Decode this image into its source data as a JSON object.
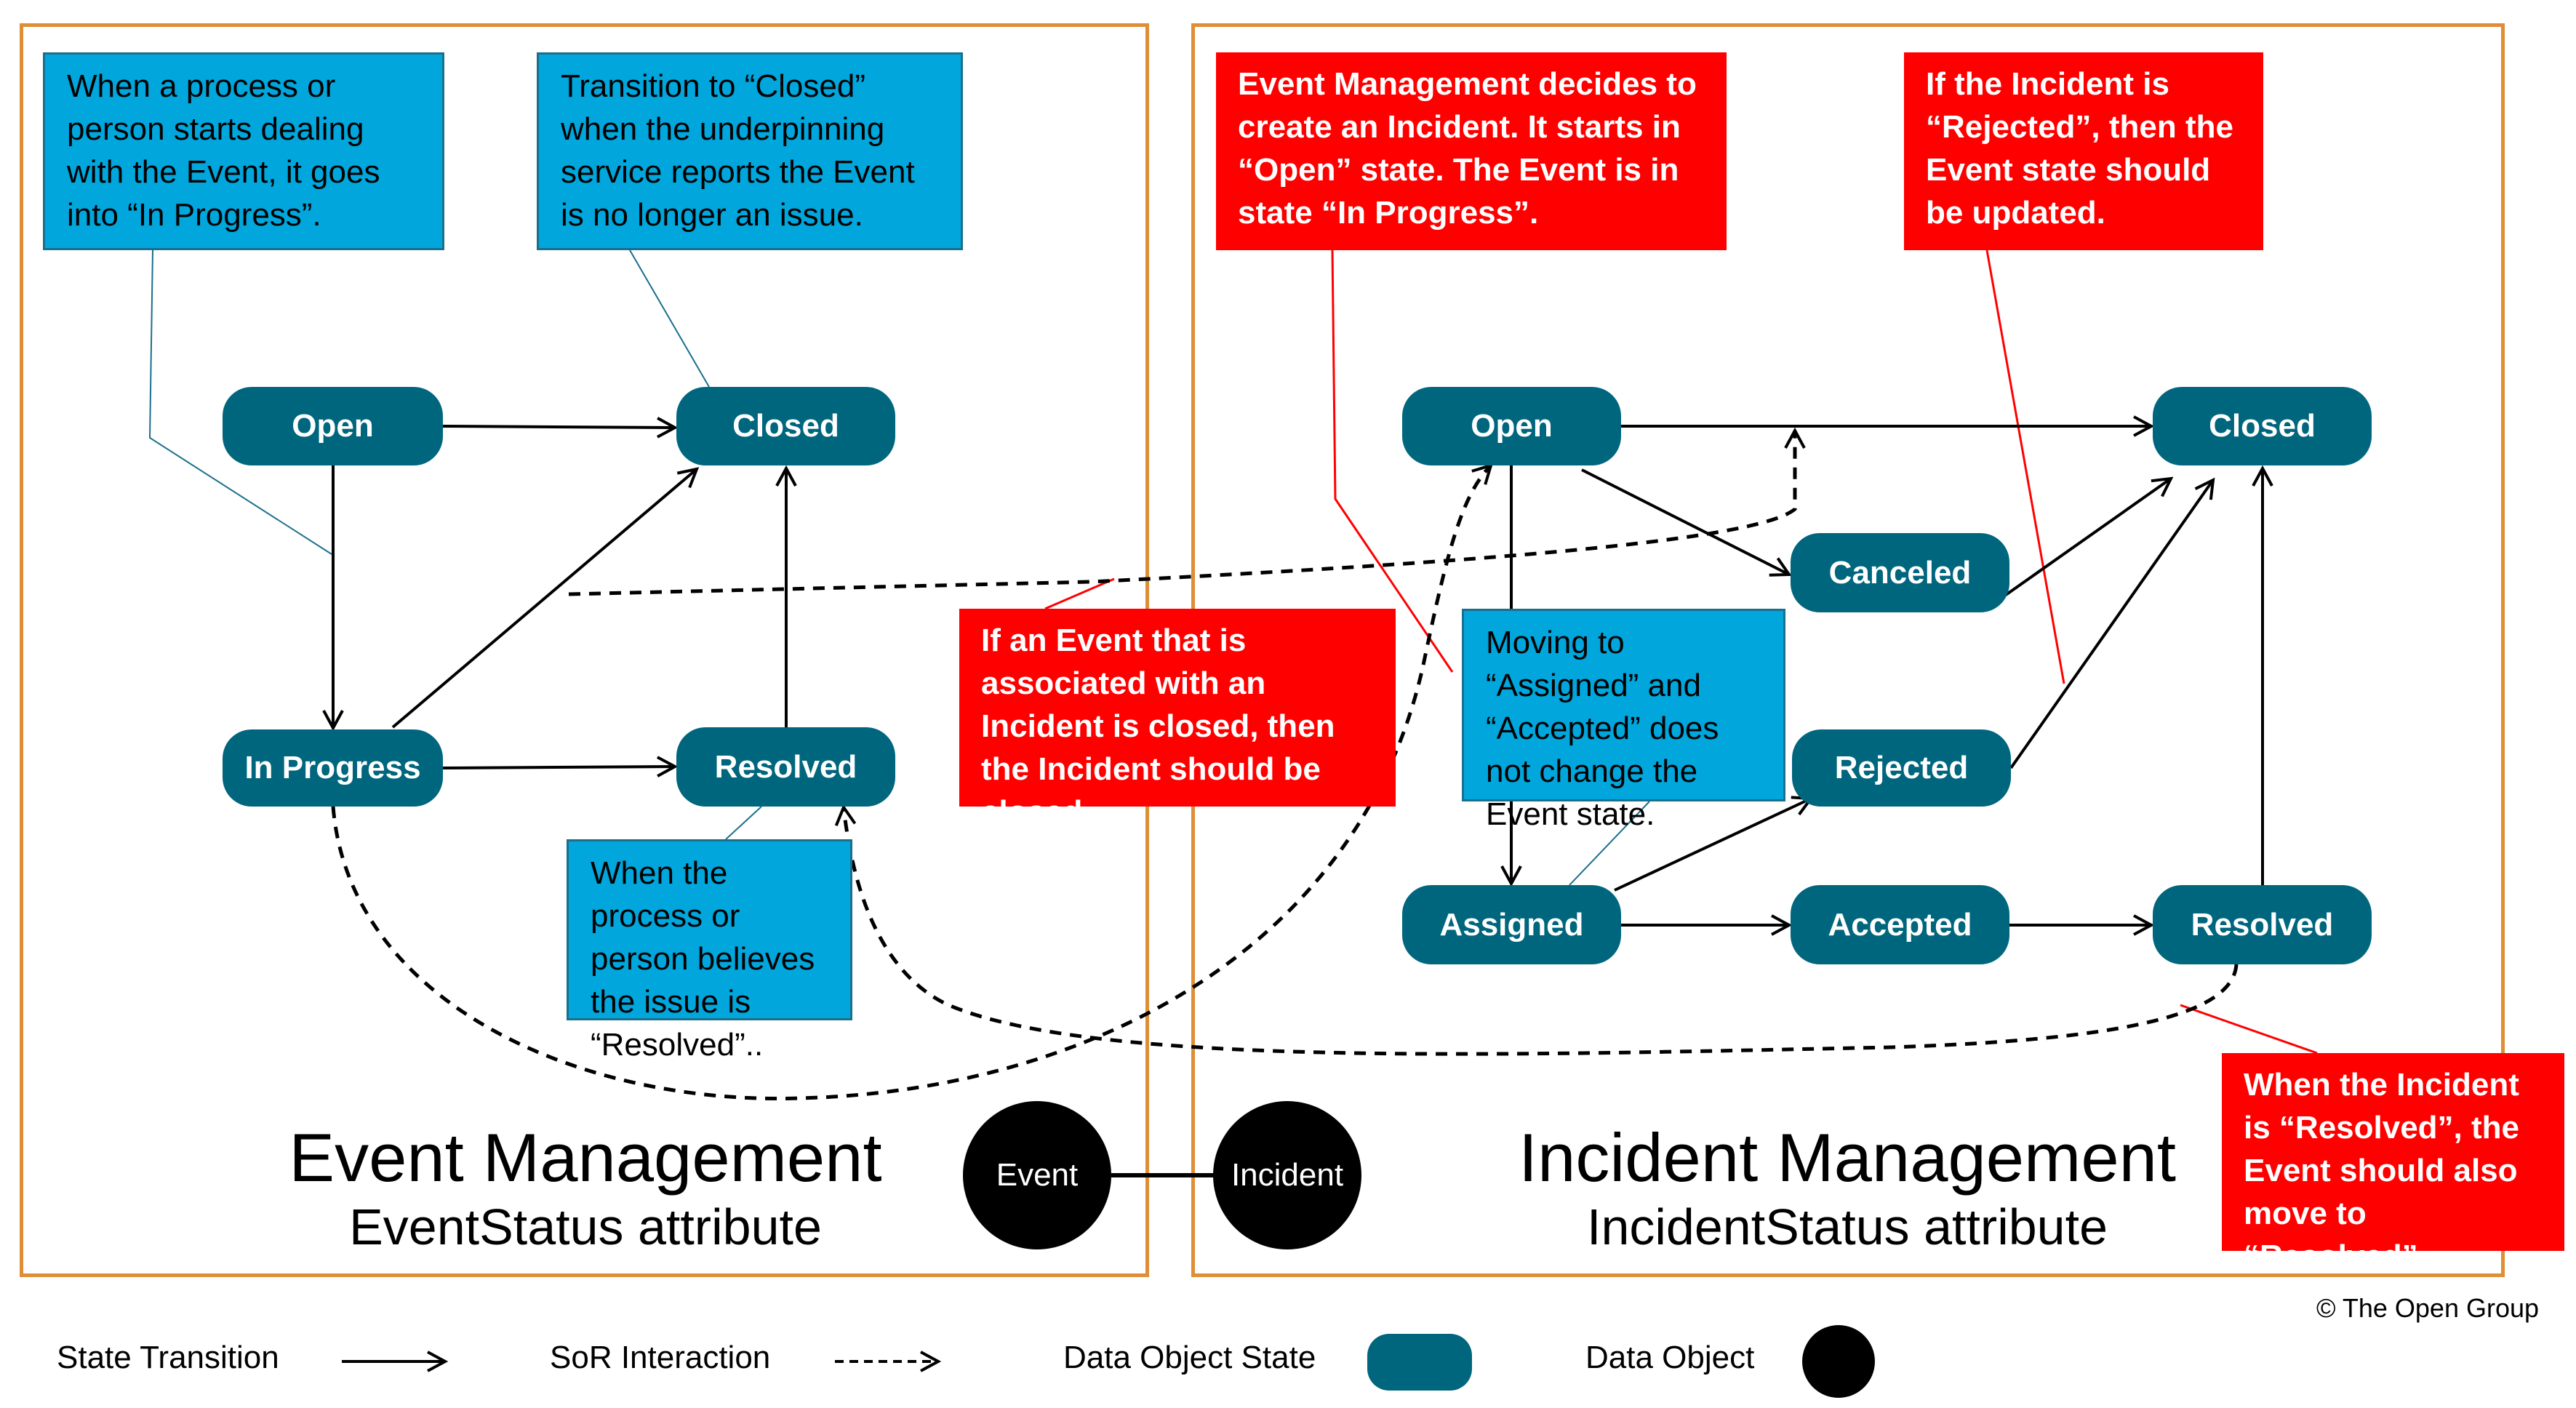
{
  "panels": {
    "event": {
      "title": "Event Management",
      "subtitle": "EventStatus attribute",
      "states": {
        "open": "Open",
        "closed": "Closed",
        "in_progress": "In Progress",
        "resolved": "Resolved"
      },
      "notes": [
        "When a process or person starts dealing with the Event, it goes into “In Progress”.",
        "Transition to “Closed” when the underpinning service reports the Event is no longer an issue.",
        "When the process or person believes the issue is “Resolved”.."
      ]
    },
    "incident": {
      "title": "Incident Management",
      "subtitle": "IncidentStatus attribute",
      "states": {
        "open": "Open",
        "closed": "Closed",
        "canceled": "Canceled",
        "rejected": "Rejected",
        "assigned": "Assigned",
        "accepted": "Accepted",
        "resolved": "Resolved"
      },
      "notes": [
        "Moving to “Assigned” and “Accepted” does not change the Event state."
      ]
    }
  },
  "red_notes": {
    "create_incident": "Event Management decides to create an Incident. It starts in “Open” state. The Event is in state “In Progress”.",
    "rejected": "If the Incident is “Rejected”, then the Event state should be updated.",
    "event_closed": "If an Event that is associated with an Incident is closed, then the Incident should be closed.",
    "incident_resolved": "When the Incident is “Resolved”, the Event should also move to “Resolved”."
  },
  "data_objects": {
    "event": "Event",
    "incident": "Incident"
  },
  "legend": {
    "state_transition": "State Transition",
    "sor_interaction": "SoR Interaction",
    "data_object_state": "Data Object State",
    "data_object": "Data Object"
  },
  "copyright": "© The Open Group",
  "colors": {
    "state": "#00667e",
    "blue_note": "#00a6dc",
    "red_note": "#ff0000",
    "panel_border": "#e08e35"
  }
}
